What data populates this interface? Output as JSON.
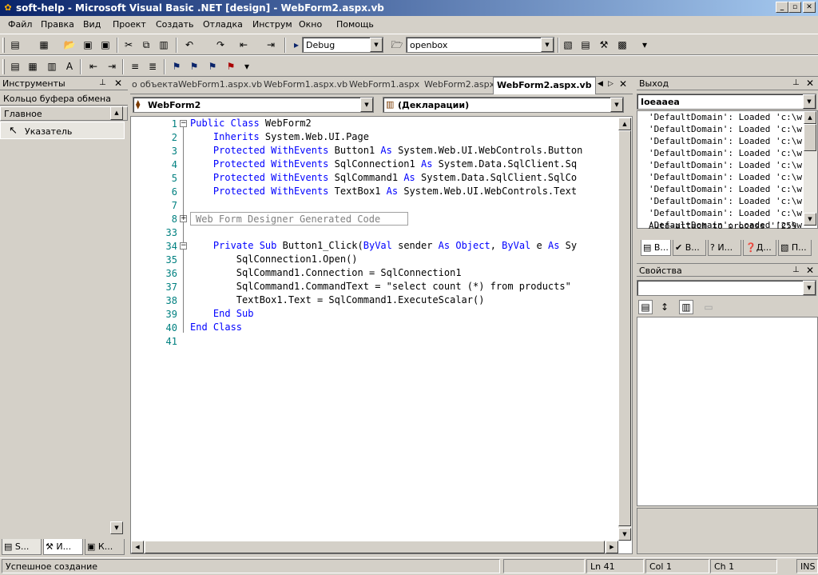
{
  "window": {
    "title": "soft-help - Microsoft Visual Basic .NET [design] - WebForm2.aspx.vb"
  },
  "menu": [
    "Файл",
    "Правка",
    "Вид",
    "Проект",
    "Создать",
    "Отладка",
    "Инструм",
    "Окно",
    "Помощь"
  ],
  "toolbar": {
    "config": "Debug",
    "target": "openbox"
  },
  "toolbox": {
    "title": "Инструменты",
    "section1": "Кольцо буфера обмена",
    "section2": "Главное",
    "pointer": "Указатель",
    "tabs": [
      "S...",
      "И...",
      "К..."
    ]
  },
  "tabs": {
    "overflow": "о объекта",
    "items": [
      "WebForm1.aspx.vb",
      "WebForm1.aspx.vb",
      "WebForm1.aspx",
      "WebForm2.aspx",
      "WebForm2.aspx.vb"
    ]
  },
  "editor": {
    "class_combo": "WebForm2",
    "method_combo": "(Декларации)",
    "lines": [
      {
        "n": "1",
        "segs": [
          {
            "t": "Public Class",
            "k": 1
          },
          {
            "t": " WebForm2",
            "k": 0
          }
        ]
      },
      {
        "n": "2",
        "segs": [
          {
            "t": "    Inherits",
            "k": 1
          },
          {
            "t": " System.Web.UI.Page",
            "k": 0
          }
        ]
      },
      {
        "n": "3",
        "segs": [
          {
            "t": "    Protected WithEvents",
            "k": 1
          },
          {
            "t": " Button1 ",
            "k": 0
          },
          {
            "t": "As",
            "k": 1
          },
          {
            "t": " System.Web.UI.WebControls.Button",
            "k": 0
          }
        ]
      },
      {
        "n": "4",
        "segs": [
          {
            "t": "    Protected WithEvents",
            "k": 1
          },
          {
            "t": " SqlConnection1 ",
            "k": 0
          },
          {
            "t": "As",
            "k": 1
          },
          {
            "t": " System.Data.SqlClient.Sq",
            "k": 0
          }
        ]
      },
      {
        "n": "5",
        "segs": [
          {
            "t": "    Protected WithEvents",
            "k": 1
          },
          {
            "t": " SqlCommand1 ",
            "k": 0
          },
          {
            "t": "As",
            "k": 1
          },
          {
            "t": " System.Data.SqlClient.SqlCo",
            "k": 0
          }
        ]
      },
      {
        "n": "6",
        "segs": [
          {
            "t": "    Protected WithEvents",
            "k": 1
          },
          {
            "t": " TextBox1 ",
            "k": 0
          },
          {
            "t": "As",
            "k": 1
          },
          {
            "t": " System.Web.UI.WebControls.Text",
            "k": 0
          }
        ]
      },
      {
        "n": "7",
        "segs": []
      },
      {
        "n": "8",
        "segs": []
      },
      {
        "n": "33",
        "segs": []
      },
      {
        "n": "34",
        "segs": [
          {
            "t": "    Private Sub",
            "k": 1
          },
          {
            "t": " Button1_Click(",
            "k": 0
          },
          {
            "t": "ByVal",
            "k": 1
          },
          {
            "t": " sender ",
            "k": 0
          },
          {
            "t": "As Object",
            "k": 1
          },
          {
            "t": ", ",
            "k": 0
          },
          {
            "t": "ByVal",
            "k": 1
          },
          {
            "t": " e ",
            "k": 0
          },
          {
            "t": "As",
            "k": 1
          },
          {
            "t": " Sy",
            "k": 0
          }
        ]
      },
      {
        "n": "35",
        "segs": [
          {
            "t": "        SqlConnection1.Open()",
            "k": 0
          }
        ]
      },
      {
        "n": "36",
        "segs": [
          {
            "t": "        SqlCommand1.Connection = SqlConnection1",
            "k": 0
          }
        ]
      },
      {
        "n": "37",
        "segs": [
          {
            "t": "        SqlCommand1.CommandText = \"select count (*) from products\"",
            "k": 0
          }
        ]
      },
      {
        "n": "38",
        "segs": [
          {
            "t": "        TextBox1.Text = SqlCommand1.ExecuteScalar()",
            "k": 0
          }
        ]
      },
      {
        "n": "39",
        "segs": [
          {
            "t": "    End Sub",
            "k": 1
          }
        ]
      },
      {
        "n": "40",
        "segs": [
          {
            "t": "End Class",
            "k": 1
          }
        ]
      },
      {
        "n": "41",
        "segs": []
      }
    ],
    "region_label": "Web Form Designer Generated Code"
  },
  "output": {
    "title": "Выход",
    "combo": "Ioeaaea",
    "lines": [
      "'DefaultDomain': Loaded 'c:\\w",
      "'DefaultDomain': Loaded 'c:\\w",
      "'DefaultDomain': Loaded 'c:\\w",
      "'DefaultDomain': Loaded 'c:\\w",
      "'DefaultDomain': Loaded 'c:\\w",
      "'DefaultDomain': Loaded 'c:\\w",
      "'DefaultDomain': Loaded 'c:\\w",
      "'DefaultDomain': Loaded 'c:\\w",
      "'DefaultDomain': Loaded 'c:\\w",
      "'DefaultDomain': Loaded 'c:\\w"
    ],
    "partial": "Auto-attach to process '[259",
    "tabs": [
      "В...",
      "В...",
      "И...",
      "Д...",
      "П..."
    ]
  },
  "properties": {
    "title": "Свойства"
  },
  "status": {
    "message": "Успешное создание",
    "ln": "Ln 41",
    "col": "Col 1",
    "ch": "Ch 1",
    "ins": "INS"
  }
}
